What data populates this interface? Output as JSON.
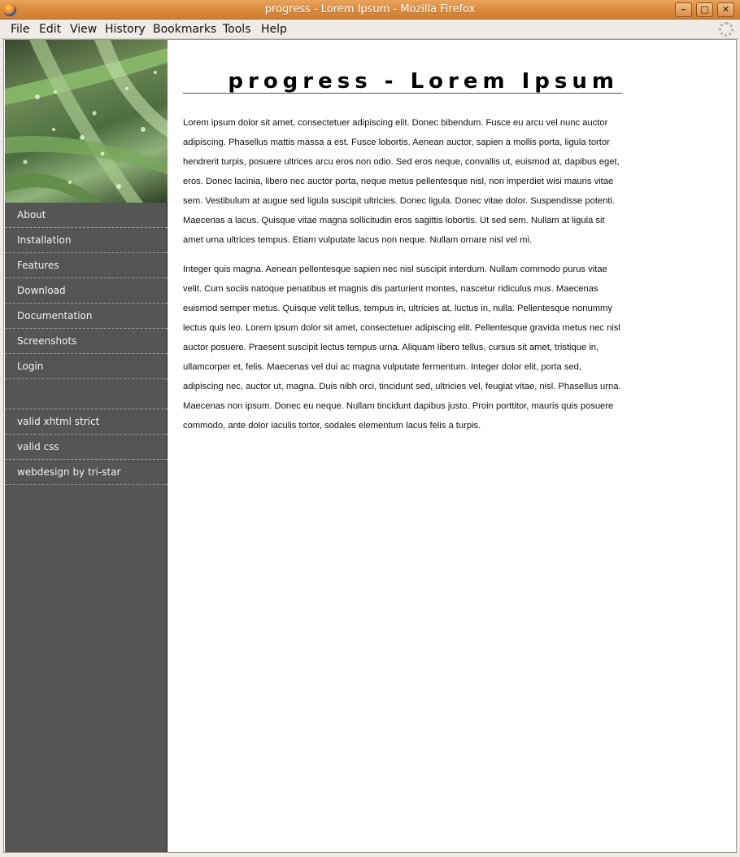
{
  "window": {
    "title": "progress - Lorem Ipsum - Mozilla Firefox",
    "min_glyph": "–",
    "max_glyph": "□",
    "close_glyph": "✕"
  },
  "menubar": {
    "items": [
      "File",
      "Edit",
      "View",
      "History",
      "Bookmarks",
      "Tools",
      "Help"
    ]
  },
  "sidebar": {
    "nav": [
      "About",
      "Installation",
      "Features",
      "Download",
      "Documentation",
      "Screenshots",
      "Login"
    ],
    "footer_links": [
      "valid xhtml strict",
      "valid css",
      "webdesign by tri-star"
    ]
  },
  "content": {
    "title": "progress - Lorem Ipsum",
    "paragraphs": [
      "Lorem ipsum dolor sit amet, consectetuer adipiscing elit. Donec bibendum. Fusce eu arcu vel nunc auctor adipiscing. Phasellus mattis massa a est. Fusce lobortis. Aenean auctor, sapien a mollis porta, ligula tortor hendrerit turpis, posuere ultrices arcu eros non odio. Sed eros neque, convallis ut, euismod at, dapibus eget, eros. Donec lacinia, libero nec auctor porta, neque metus pellentesque nisl, non imperdiet wisi mauris vitae sem. Vestibulum at augue sed ligula suscipit ultricies. Donec ligula. Donec vitae dolor. Suspendisse potenti. Maecenas a lacus. Quisque vitae magna sollicitudin eros sagittis lobortis. Ut sed sem. Nullam at ligula sit amet urna ultrices tempus. Etiam vulputate lacus non neque. Nullam ornare nisl vel mi.",
      "Integer quis magna. Aenean pellentesque sapien nec nisl suscipit interdum. Nullam commodo purus vitae velit. Cum sociis natoque penatibus et magnis dis parturient montes, nascetur ridiculus mus. Maecenas euismod semper metus. Quisque velit tellus, tempus in, ultricies at, luctus in, nulla. Pellentesque nonummy lectus quis leo. Lorem ipsum dolor sit amet, consectetuer adipiscing elit. Pellentesque gravida metus nec nisl auctor posuere. Praesent suscipit lectus tempus urna. Aliquam libero tellus, cursus sit amet, tristique in, ullamcorper et, felis. Maecenas vel dui ac magna vulputate fermentum. Integer dolor elit, porta sed, adipiscing nec, auctor ut, magna. Duis nibh orci, tincidunt sed, ultricies vel, feugiat vitae, nisl. Phasellus urna. Maecenas non ipsum. Donec eu neque. Nullam tincidunt dapibus justo. Proin porttitor, mauris quis posuere commodo, ante dolor iaculis tortor, sodales elementum lacus felis a turpis."
    ]
  },
  "colors": {
    "sidebar_bg": "#555555",
    "titlebar": "#d98a3c",
    "content_bg": "#ffffff"
  },
  "icons": [
    "firefox-icon",
    "throbber-icon",
    "grass-header-image"
  ]
}
